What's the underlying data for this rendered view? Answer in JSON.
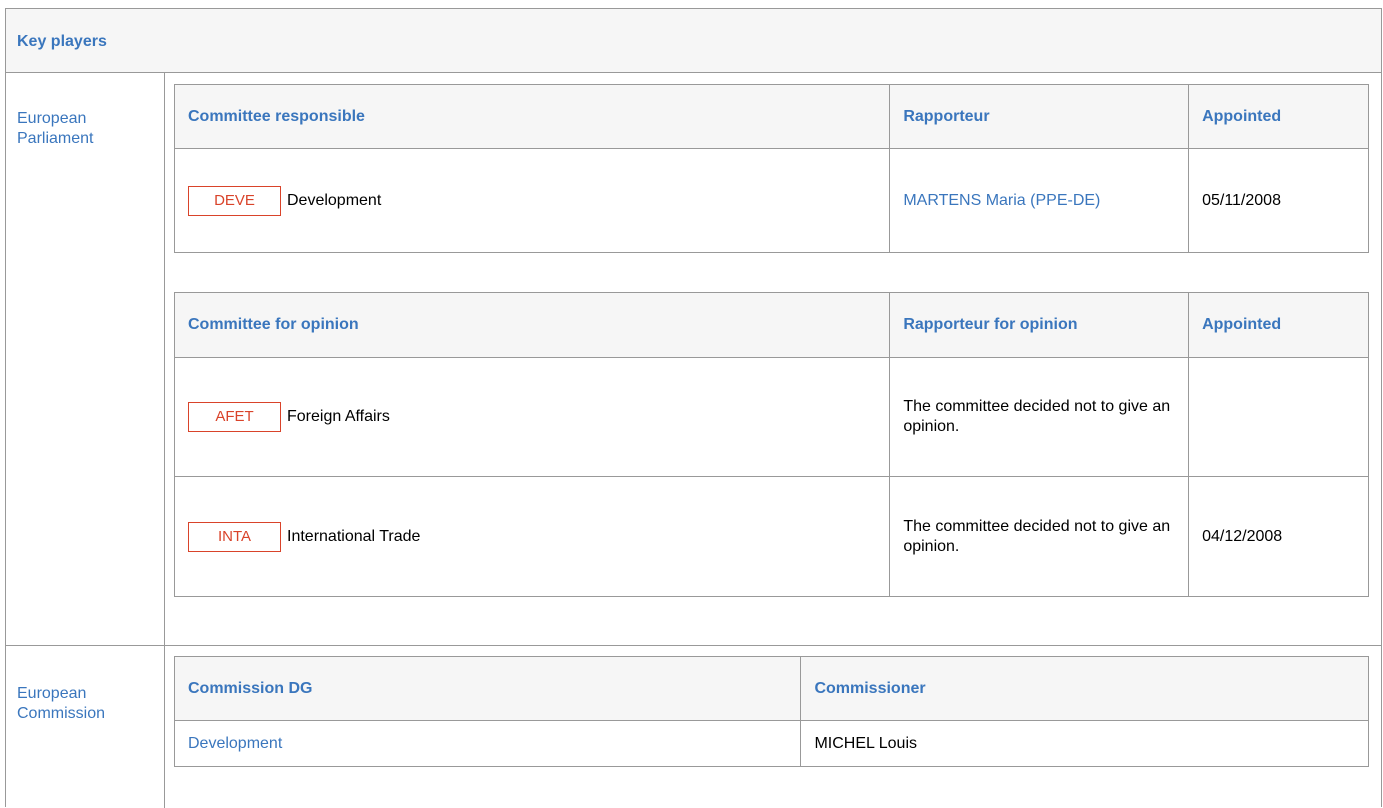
{
  "section": {
    "title": "Key players"
  },
  "parliament": {
    "label": "European Parliament",
    "responsible": {
      "headers": {
        "committee": "Committee responsible",
        "rapporteur": "Rapporteur",
        "appointed": "Appointed"
      },
      "rows": [
        {
          "code": "DEVE",
          "name": "Development",
          "rapporteur": "MARTENS Maria (PPE-DE)",
          "appointed": "05/11/2008"
        }
      ]
    },
    "opinion": {
      "headers": {
        "committee": "Committee for opinion",
        "rapporteur": "Rapporteur for opinion",
        "appointed": "Appointed"
      },
      "rows": [
        {
          "code": "AFET",
          "name": "Foreign Affairs",
          "rapporteur": "The committee decided not to give an opinion.",
          "appointed": ""
        },
        {
          "code": "INTA",
          "name": "International Trade",
          "rapporteur": "The committee decided not to give an opinion.",
          "appointed": "04/12/2008"
        }
      ]
    }
  },
  "commission": {
    "label": "European Commission",
    "headers": {
      "dg": "Commission DG",
      "commissioner": "Commissioner"
    },
    "rows": [
      {
        "dg": "Development",
        "commissioner": "MICHEL Louis"
      }
    ]
  },
  "colors": {
    "link": "#3a76bd",
    "badge": "#d9432a",
    "border": "#999999",
    "header_bg": "#f6f6f6"
  }
}
